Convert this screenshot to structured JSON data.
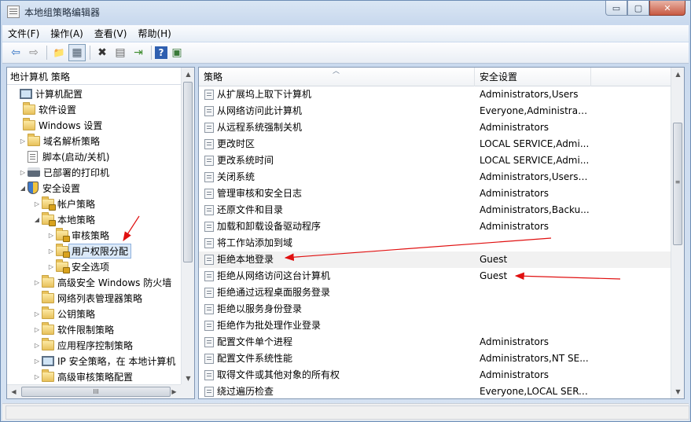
{
  "window": {
    "title": "本地组策略编辑器"
  },
  "controls": {
    "minimize": "▭",
    "maximize": "▢",
    "close": "✕"
  },
  "menu": [
    "文件(F)",
    "操作(A)",
    "查看(V)",
    "帮助(H)"
  ],
  "toolbar": [
    {
      "icon": "back-arrow-icon",
      "glyph": "⇦"
    },
    {
      "icon": "forward-arrow-icon",
      "glyph": "⇨"
    },
    {
      "icon": "up-folder-icon",
      "glyph": "📁"
    },
    {
      "icon": "show-tree-icon",
      "glyph": "▦"
    },
    {
      "icon": "delete-icon",
      "glyph": "✖"
    },
    {
      "icon": "properties-icon",
      "glyph": "▤"
    },
    {
      "icon": "export-icon",
      "glyph": "⇥"
    },
    {
      "icon": "help-icon",
      "glyph": "?"
    },
    {
      "icon": "mmc-icon",
      "glyph": "▣"
    }
  ],
  "tree": {
    "header": "地计算机 策略",
    "items": [
      {
        "label": "计算机配置",
        "level": 0,
        "exp": "",
        "icon": "pc"
      },
      {
        "label": "软件设置",
        "level": 1,
        "exp": "",
        "icon": "folder"
      },
      {
        "label": "Windows 设置",
        "level": 1,
        "exp": "",
        "icon": "folder"
      },
      {
        "label": "域名解析策略",
        "level": 2,
        "exp": "▷",
        "icon": "folder"
      },
      {
        "label": "脚本(启动/关机)",
        "level": 2,
        "exp": "",
        "icon": "doc"
      },
      {
        "label": "已部署的打印机",
        "level": 2,
        "exp": "▷",
        "icon": "printer"
      },
      {
        "label": "安全设置",
        "level": 2,
        "exp": "◢",
        "icon": "shield"
      },
      {
        "label": "帐户策略",
        "level": 3,
        "exp": "▷",
        "icon": "folderlock"
      },
      {
        "label": "本地策略",
        "level": 3,
        "exp": "◢",
        "icon": "folderlock"
      },
      {
        "label": "审核策略",
        "level": 4,
        "exp": "▷",
        "icon": "folderlock"
      },
      {
        "label": "用户权限分配",
        "level": 4,
        "exp": "▷",
        "icon": "folderlock",
        "selected": true
      },
      {
        "label": "安全选项",
        "level": 4,
        "exp": "▷",
        "icon": "folderlock"
      },
      {
        "label": "高级安全 Windows 防火墙",
        "level": 3,
        "exp": "▷",
        "icon": "folder"
      },
      {
        "label": "网络列表管理器策略",
        "level": 3,
        "exp": "",
        "icon": "folder"
      },
      {
        "label": "公钥策略",
        "level": 3,
        "exp": "▷",
        "icon": "folder"
      },
      {
        "label": "软件限制策略",
        "level": 3,
        "exp": "▷",
        "icon": "folder"
      },
      {
        "label": "应用程序控制策略",
        "level": 3,
        "exp": "▷",
        "icon": "folder"
      },
      {
        "label": "IP 安全策略，在 本地计算机",
        "level": 3,
        "exp": "▷",
        "icon": "pc"
      },
      {
        "label": "高级审核策略配置",
        "level": 3,
        "exp": "▷",
        "icon": "folder"
      }
    ]
  },
  "list": {
    "columns": [
      "策略",
      "安全设置"
    ],
    "rows": [
      {
        "policy": "从扩展坞上取下计算机",
        "setting": "Administrators,Users"
      },
      {
        "policy": "从网络访问此计算机",
        "setting": "Everyone,Administrat..."
      },
      {
        "policy": "从远程系统强制关机",
        "setting": "Administrators"
      },
      {
        "policy": "更改时区",
        "setting": "LOCAL SERVICE,Admi..."
      },
      {
        "policy": "更改系统时间",
        "setting": "LOCAL SERVICE,Admi..."
      },
      {
        "policy": "关闭系统",
        "setting": "Administrators,Users,..."
      },
      {
        "policy": "管理审核和安全日志",
        "setting": "Administrators"
      },
      {
        "policy": "还原文件和目录",
        "setting": "Administrators,Backu..."
      },
      {
        "policy": "加载和卸载设备驱动程序",
        "setting": "Administrators"
      },
      {
        "policy": "将工作站添加到域",
        "setting": ""
      },
      {
        "policy": "拒绝本地登录",
        "setting": "Guest",
        "hover": true
      },
      {
        "policy": "拒绝从网络访问这台计算机",
        "setting": "Guest"
      },
      {
        "policy": "拒绝通过远程桌面服务登录",
        "setting": ""
      },
      {
        "policy": "拒绝以服务身份登录",
        "setting": ""
      },
      {
        "policy": "拒绝作为批处理作业登录",
        "setting": ""
      },
      {
        "policy": "配置文件单个进程",
        "setting": "Administrators"
      },
      {
        "policy": "配置文件系统性能",
        "setting": "Administrators,NT SE..."
      },
      {
        "policy": "取得文件或其他对象的所有权",
        "setting": "Administrators"
      },
      {
        "policy": "绕过遍历检查",
        "setting": "Everyone,LOCAL SERV..."
      }
    ]
  },
  "scroll_glyphs": {
    "up": "▲",
    "down": "▼",
    "left": "◀",
    "right": "▶",
    "grip_h": "III",
    "grip_v": "≡"
  },
  "colors": {
    "annotation": "#e01010",
    "selection": "#dbe9f8"
  }
}
